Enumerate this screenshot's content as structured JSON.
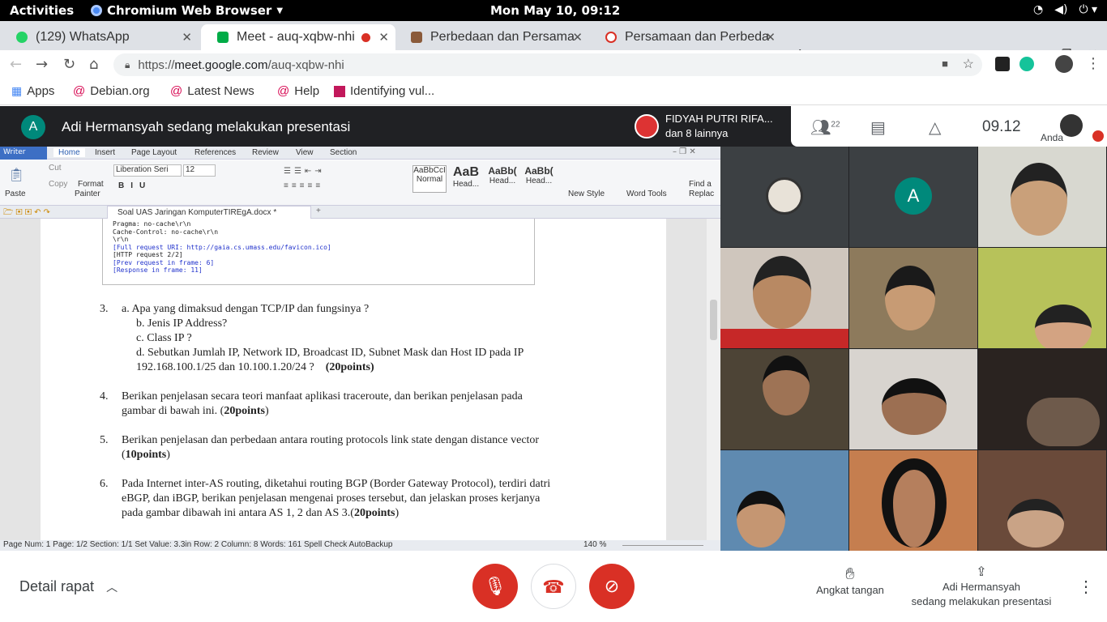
{
  "system": {
    "activities": "Activities",
    "app_name": "Chromium Web Browser",
    "clock": "Mon May 10, 09:12"
  },
  "tabs": [
    {
      "title": "(129) WhatsApp"
    },
    {
      "title": "Meet - auq-xqbw-nhi"
    },
    {
      "title": "Perbedaan dan Persama"
    },
    {
      "title": "Persamaan dan Perbeda"
    }
  ],
  "address": {
    "url_prefix": "https://",
    "url_host": "meet.google.com",
    "url_path": "/auq-xqbw-nhi"
  },
  "bookmarks": [
    "Apps",
    "Debian.org",
    "Latest News",
    "Help",
    "Identifying vul..."
  ],
  "meet": {
    "presenter_initial": "A",
    "presenting_title": "Adi Hermansyah sedang melakukan presentasi",
    "speaker_name": "FIDYAH PUTRI RIFA...",
    "speaker_sub": "dan 8 lainnya",
    "participants_count": "22",
    "time": "09.12",
    "you_label": "Anda",
    "tile_initial": "A"
  },
  "wps": {
    "writer": "Writer",
    "menu": [
      "Home",
      "Insert",
      "Page Layout",
      "References",
      "Review",
      "View",
      "Section"
    ],
    "paste": "Paste",
    "cut": "Cut",
    "copy": "Copy",
    "format_painter_1": "Format",
    "format_painter_2": "Painter",
    "font": "Liberation Seri",
    "size": "12",
    "styles": [
      {
        "sample": "AaBbCcI",
        "name": "Normal"
      },
      {
        "sample": "AaB",
        "name": "Head..."
      },
      {
        "sample": "AaBb(",
        "name": "Head..."
      },
      {
        "sample": "AaBb(",
        "name": "Head..."
      }
    ],
    "new_style": "New Style",
    "word_tools": "Word Tools",
    "find_1": "Find a",
    "find_2": "Replac",
    "doc_tab": "Soal UAS Jaringan KomputerTIREgA.docx *",
    "status": "Page Num: 1   Page: 1/2   Section: 1/1   Set Value: 3.3in   Row: 2   Column: 8   Words: 161   Spell Check   AutoBackup",
    "zoom": "140 %"
  },
  "capture_lines": [
    {
      "text": "Pragma: no-cache\\r\\n",
      "link": false
    },
    {
      "text": "Cache-Control: no-cache\\r\\n",
      "link": false
    },
    {
      "text": "\\r\\n",
      "link": false
    },
    {
      "text": "[Full request URI: http://gaia.cs.umass.edu/favicon.ico]",
      "link": true
    },
    {
      "text": "[HTTP request 2/2]",
      "link": false
    },
    {
      "text": "[Prev request in frame: 6]",
      "link": true
    },
    {
      "text": "[Response in frame: 11]",
      "link": true
    }
  ],
  "questions": {
    "q3_num": "3.",
    "q3a": "a. Apa yang dimaksud dengan TCP/IP dan fungsinya ?",
    "q3b": "b. Jenis IP Address?",
    "q3c": "c. Class IP ?",
    "q3d1": "d. Sebutkan Jumlah IP, Network ID, Broadcast ID, Subnet Mask dan Host ID pada IP",
    "q3d2": "192.168.100.1/25    dan 10.100.1.20/24 ?",
    "q3d_pts": "(20points)",
    "q4_num": "4.",
    "q4_1": "Berikan penjelasan secara teori manfaat aplikasi traceroute, dan berikan penjelasan pada",
    "q4_2": "gambar di bawah ini. (",
    "q4_pts": "20points",
    "q4_end": ")",
    "q5_num": "5.",
    "q5_1": "Berikan penjelasan dan perbedaan antara routing protocols link state dengan distance vector",
    "q5_2": "(",
    "q5_pts": "10points",
    "q5_end": ")",
    "q6_num": "6.",
    "q6_1": "Pada Internet inter-AS routing, diketahui routing BGP (Border Gateway Protocol), terdiri datri",
    "q6_2": "eBGP, dan iBGP, berikan penjelasan mengenai proses tersebut, dan jelaskan proses kerjanya",
    "q6_3": "pada gambar dibawah ini antara AS 1, 2 dan AS 3.(",
    "q6_pts": "20points",
    "q6_end": ")"
  },
  "bottom": {
    "details": "Detail rapat",
    "raise_hand": "Angkat tangan",
    "presenting_1": "Adi Hermansyah",
    "presenting_2": "sedang melakukan presentasi"
  },
  "colors": {
    "meet_dark": "#202124",
    "red": "#d93025",
    "teal": "#00897b",
    "wps_blue": "#3d6fc4"
  }
}
